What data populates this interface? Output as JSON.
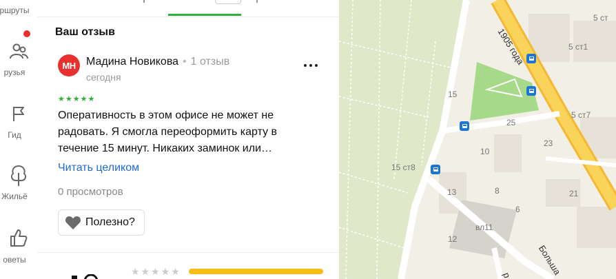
{
  "nav": {
    "items": [
      {
        "label": "ршруты"
      },
      {
        "label": "рузья"
      },
      {
        "label": "Гид"
      },
      {
        "label": "Жильё"
      },
      {
        "label": "оветы"
      }
    ]
  },
  "review": {
    "section_title": "Ваш отзыв",
    "avatar_initials": "МН",
    "author_name": "Мадина Новикова",
    "author_separator": "•",
    "review_count": "1 отзыв",
    "date": "сегодня",
    "stars": "★★★★★",
    "rating": 5,
    "text": "Оперативность в этом офисе не может не радовать. Я смогла переоформить карту в течение 15 минут. Никаких заминок или…",
    "read_more": "Читать целиком",
    "views": "0 просмотров",
    "useful_label": "Полезно?"
  },
  "bottom": {
    "stars": "★★★★★"
  },
  "map": {
    "labels": {
      "l15": "15",
      "l15st8": "15 ст8",
      "l13": "13",
      "l12": "12",
      "l10": "10",
      "l8": "8",
      "l6": "6",
      "l25": "25",
      "l23": "23",
      "l21": "21",
      "l5st": "5 ст",
      "l5st1": "5 ст1",
      "l5st7": "5 ст7",
      "lvl11": "вл11",
      "road_1905": "1905 года",
      "road_bolsh": "Больша",
      "road_r": "р"
    }
  },
  "colors": {
    "accent_green": "#2eb136",
    "link_blue": "#1e6bd6",
    "avatar_red": "#e8302f",
    "rating_bar": "#f6bd1a",
    "transit_blue": "#1976d2"
  }
}
